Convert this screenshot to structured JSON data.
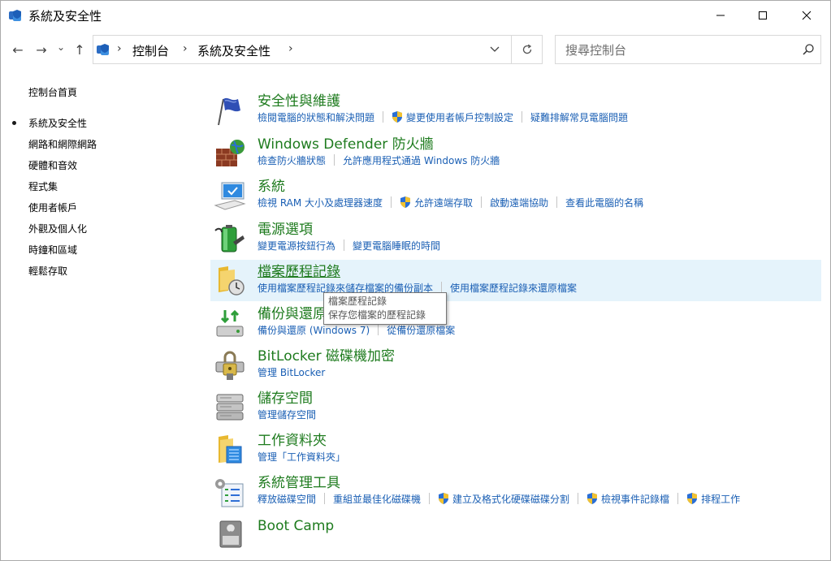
{
  "window": {
    "title": "系統及安全性"
  },
  "nav": {
    "back_icon": "←",
    "forward_icon": "→",
    "recent_icon": "⌄",
    "up_icon": "↑",
    "breadcrumbs": [
      "控制台",
      "系統及安全性"
    ],
    "separator": "›"
  },
  "search": {
    "placeholder": "搜尋控制台"
  },
  "sidebar": {
    "items": [
      {
        "label": "控制台首頁",
        "current": false
      },
      {
        "label": "系統及安全性",
        "current": true
      },
      {
        "label": "網路和網際網路",
        "current": false
      },
      {
        "label": "硬體和音效",
        "current": false
      },
      {
        "label": "程式集",
        "current": false
      },
      {
        "label": "使用者帳戶",
        "current": false
      },
      {
        "label": "外觀及個人化",
        "current": false
      },
      {
        "label": "時鐘和區域",
        "current": false
      },
      {
        "label": "輕鬆存取",
        "current": false
      }
    ]
  },
  "categories": [
    {
      "title": "安全性與維護",
      "icon": "flag-icon",
      "links": [
        {
          "label": "檢閱電腦的狀態和解決問題",
          "shield": false
        },
        {
          "label": "變更使用者帳戶控制設定",
          "shield": true
        },
        {
          "label": "疑難排解常見電腦問題",
          "shield": false
        }
      ]
    },
    {
      "title": "Windows Defender 防火牆",
      "icon": "firewall-icon",
      "links": [
        {
          "label": "檢查防火牆狀態",
          "shield": false
        },
        {
          "label": "允許應用程式通過 Windows 防火牆",
          "shield": false
        }
      ]
    },
    {
      "title": "系統",
      "icon": "computer-icon",
      "links": [
        {
          "label": "檢視 RAM 大小及處理器速度",
          "shield": false
        },
        {
          "label": "允許遠端存取",
          "shield": true
        },
        {
          "label": "啟動遠端協助",
          "shield": false
        },
        {
          "label": "查看此電腦的名稱",
          "shield": false
        }
      ]
    },
    {
      "title": "電源選項",
      "icon": "battery-icon",
      "links": [
        {
          "label": "變更電源按鈕行為",
          "shield": false
        },
        {
          "label": "變更電腦睡眠的時間",
          "shield": false
        }
      ]
    },
    {
      "title": "檔案歷程記錄",
      "icon": "file-history-icon",
      "hover": true,
      "links": [
        {
          "label": "使用檔案歷程記錄來儲存檔案的備份副本",
          "shield": false
        },
        {
          "label": "使用檔案歷程記錄來還原檔案",
          "shield": false
        }
      ]
    },
    {
      "title": "備份與還原 (Windows 7)",
      "icon": "backup-icon",
      "links": [
        {
          "label": "備份與還原 (Windows 7)",
          "shield": false
        },
        {
          "label": "從備份還原檔案",
          "shield": false
        }
      ]
    },
    {
      "title": "BitLocker 磁碟機加密",
      "icon": "bitlocker-icon",
      "links": [
        {
          "label": "管理 BitLocker",
          "shield": false
        }
      ]
    },
    {
      "title": "儲存空間",
      "icon": "storage-icon",
      "links": [
        {
          "label": "管理儲存空間",
          "shield": false
        }
      ]
    },
    {
      "title": "工作資料夾",
      "icon": "work-folders-icon",
      "links": [
        {
          "label": "管理「工作資料夾」",
          "shield": false
        }
      ]
    },
    {
      "title": "系統管理工具",
      "icon": "admin-tools-icon",
      "links": [
        {
          "label": "釋放磁碟空間",
          "shield": false
        },
        {
          "label": "重組並最佳化磁碟機",
          "shield": false
        },
        {
          "label": "建立及格式化硬碟磁碟分割",
          "shield": true
        },
        {
          "label": "檢視事件記錄檔",
          "shield": true
        },
        {
          "label": "排程工作",
          "shield": true
        }
      ]
    },
    {
      "title": "Boot Camp",
      "icon": "bootcamp-icon",
      "links": []
    }
  ],
  "tooltip": {
    "line1": "檔案歷程記錄",
    "line2": "保存您檔案的歷程記錄"
  },
  "colors": {
    "title_green": "#1e7b1e",
    "link_blue": "#1a5fb4",
    "hover_bg": "#e5f3fb"
  }
}
